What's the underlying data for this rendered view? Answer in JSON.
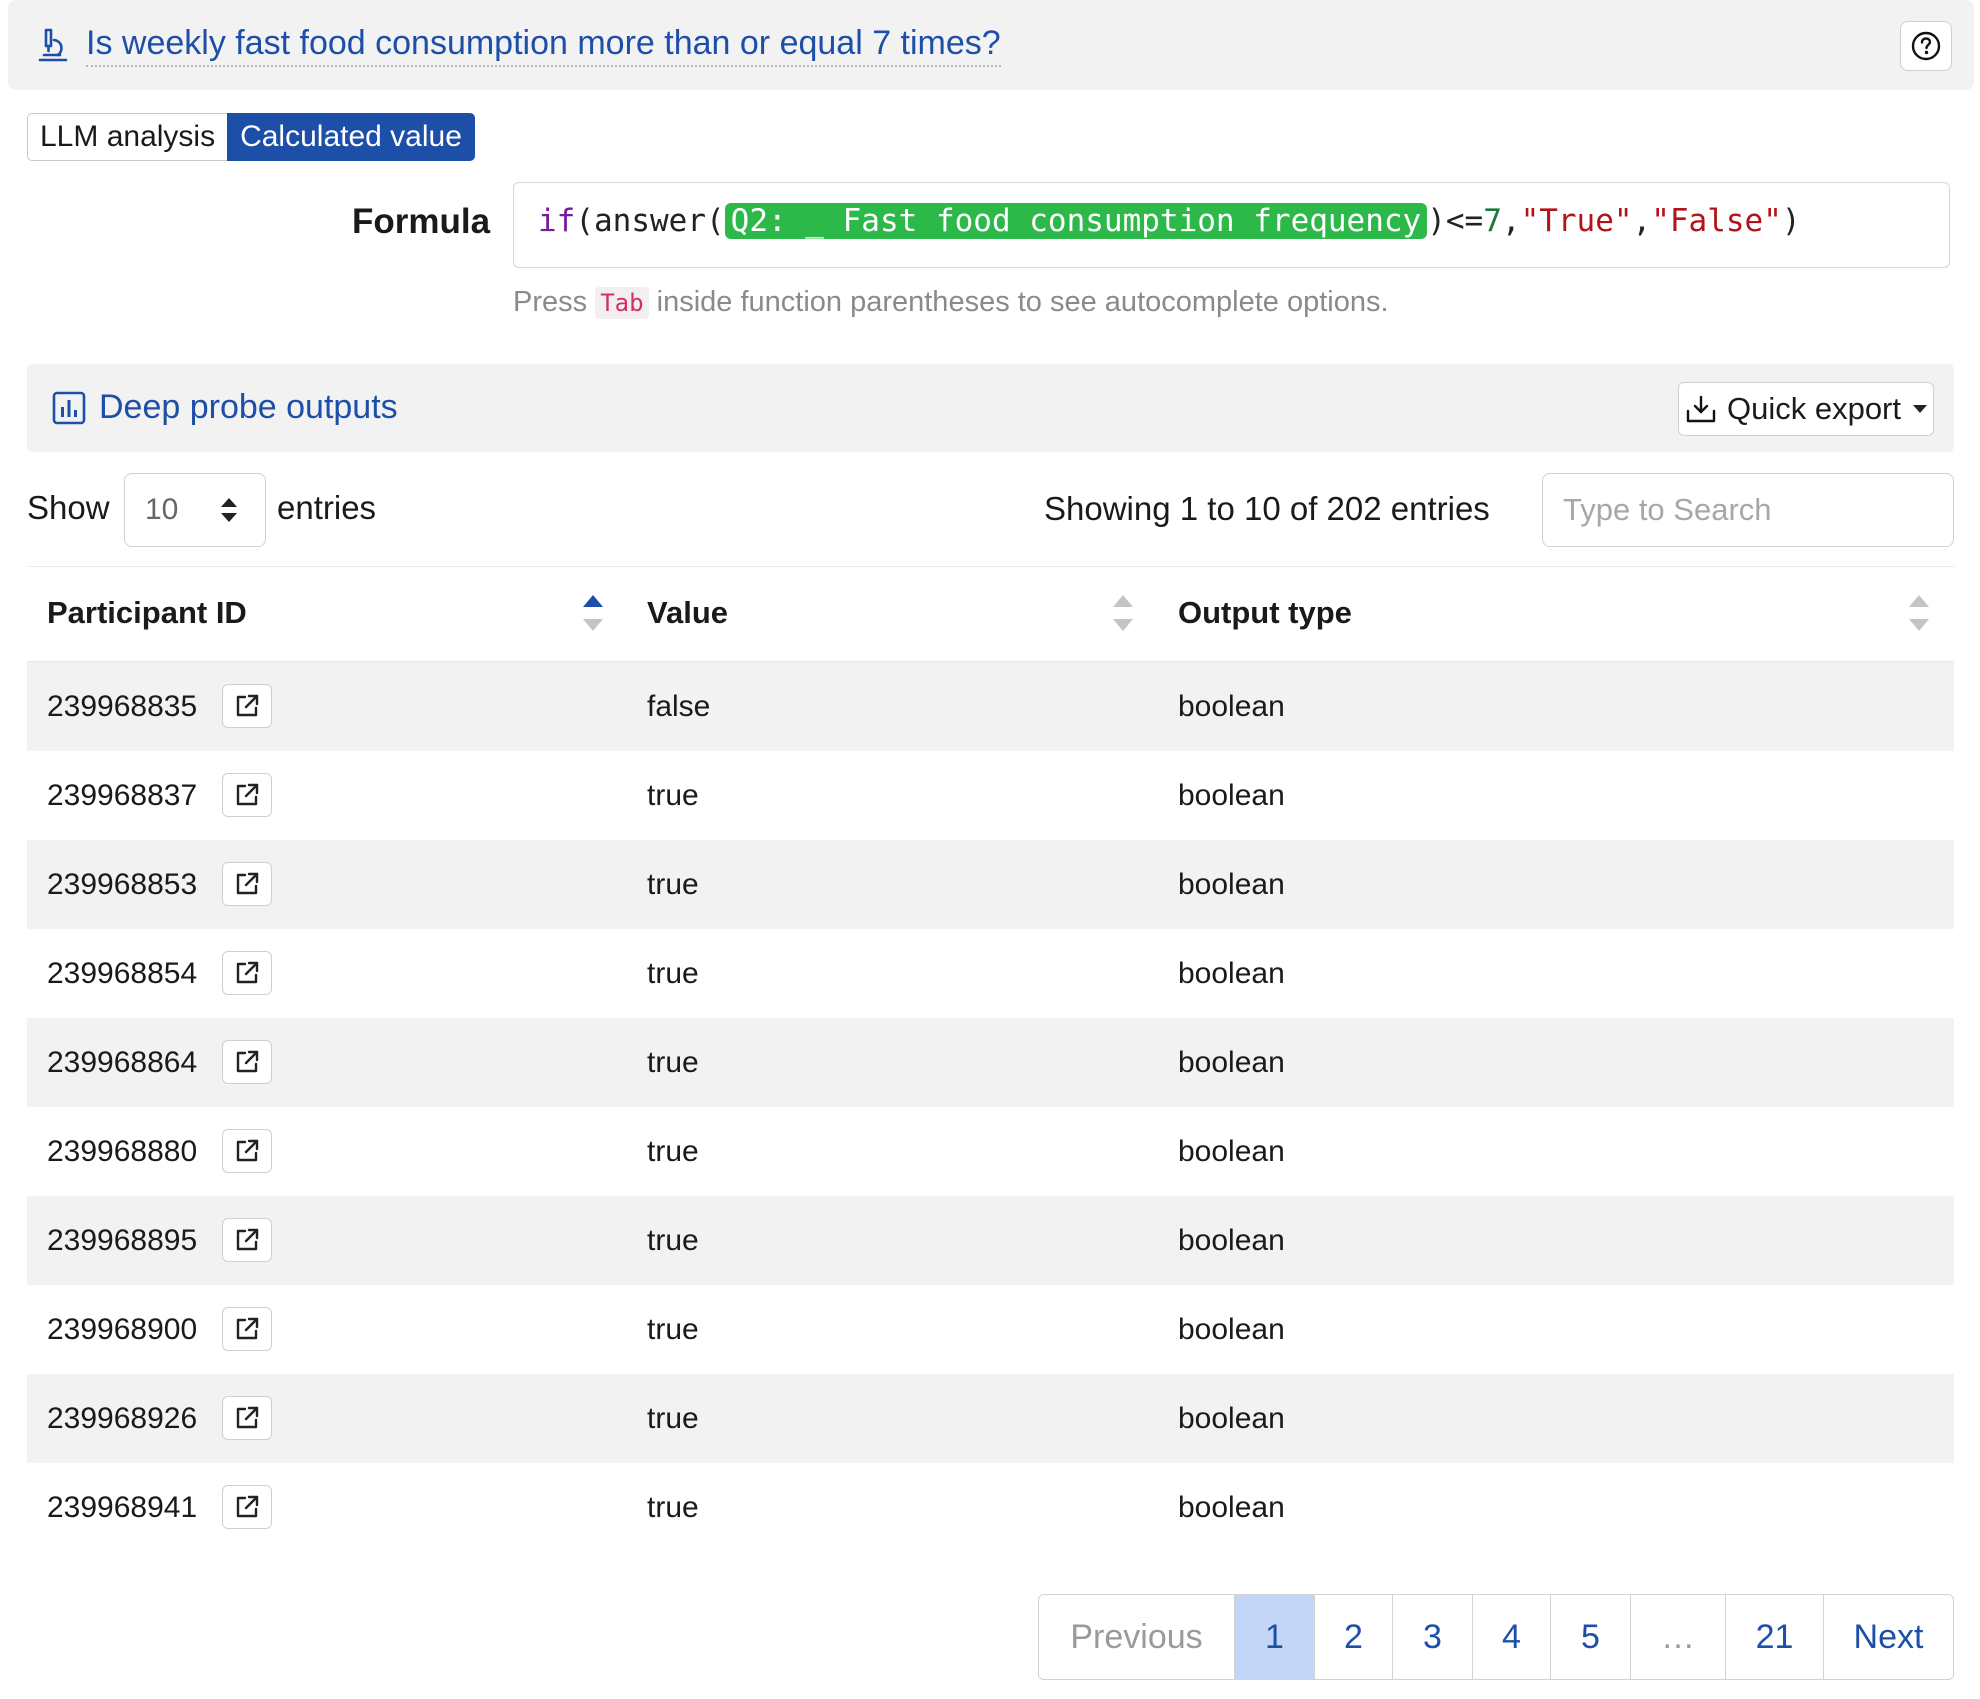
{
  "question": {
    "title": "Is weekly fast food consumption more than or equal 7 times?",
    "icon": "microscope-icon",
    "help_icon": "help-circle-icon"
  },
  "mode_tabs": [
    {
      "label": "LLM analysis",
      "active": false
    },
    {
      "label": "Calculated value",
      "active": true
    }
  ],
  "formula": {
    "label": "Formula",
    "fn_if": "if",
    "p1": "(",
    "fn_answer": "answer",
    "p2": "(",
    "token": "Q2: _ Fast food consumption frequency",
    "p3": ")<=",
    "number": "7",
    "comma1": ",",
    "true_str": "\"True\"",
    "comma2": ",",
    "false_str": "\"False\"",
    "p4": ")",
    "hint_prefix": "Press",
    "hint_key": "Tab",
    "hint_suffix": "inside function parentheses to see autocomplete options."
  },
  "deep_probe": {
    "title": "Deep probe outputs",
    "icon": "bar-chart-icon",
    "export_label": "Quick export",
    "export_icon": "download-icon"
  },
  "table_controls": {
    "show_label": "Show",
    "page_size": "10",
    "entries_label": "entries",
    "showing_text": "Showing 1 to 10 of 202 entries",
    "search_placeholder": "Type to Search"
  },
  "table": {
    "headers": [
      "Participant ID",
      "Value",
      "Output type"
    ],
    "rows": [
      {
        "id": "239968835",
        "value": "false",
        "type": "boolean"
      },
      {
        "id": "239968837",
        "value": "true",
        "type": "boolean"
      },
      {
        "id": "239968853",
        "value": "true",
        "type": "boolean"
      },
      {
        "id": "239968854",
        "value": "true",
        "type": "boolean"
      },
      {
        "id": "239968864",
        "value": "true",
        "type": "boolean"
      },
      {
        "id": "239968880",
        "value": "true",
        "type": "boolean"
      },
      {
        "id": "239968895",
        "value": "true",
        "type": "boolean"
      },
      {
        "id": "239968900",
        "value": "true",
        "type": "boolean"
      },
      {
        "id": "239968926",
        "value": "true",
        "type": "boolean"
      },
      {
        "id": "239968941",
        "value": "true",
        "type": "boolean"
      }
    ]
  },
  "pagination": {
    "previous": "Previous",
    "pages": [
      "1",
      "2",
      "3",
      "4",
      "5"
    ],
    "ellipsis": "…",
    "last": "21",
    "next": "Next",
    "current": "1"
  },
  "colors": {
    "accent": "#1d4fa8",
    "token_green": "#2db84a",
    "string_red": "#b3141c",
    "active_page": "#c3d6f8"
  }
}
